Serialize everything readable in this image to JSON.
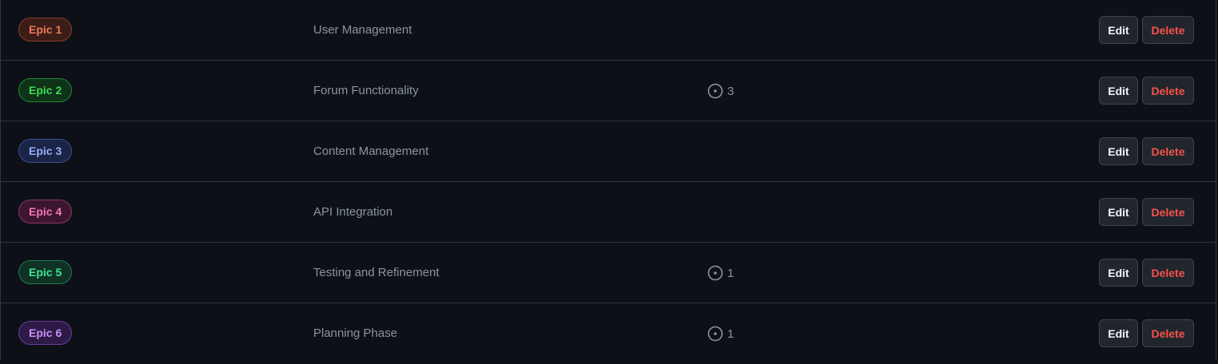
{
  "milestones": [
    {
      "label": "Epic 1",
      "description": "User Management",
      "open_issues": null,
      "color": "#f0785a",
      "bg": "#3a1d17",
      "border": "#8c3a28"
    },
    {
      "label": "Epic 2",
      "description": "Forum Functionality",
      "open_issues": "3",
      "color": "#3fdc54",
      "bg": "#0f3219",
      "border": "#238636"
    },
    {
      "label": "Epic 3",
      "description": "Content Management",
      "open_issues": null,
      "color": "#99aff5",
      "bg": "#1a2447",
      "border": "#3b4d8f"
    },
    {
      "label": "Epic 4",
      "description": "API Integration",
      "open_issues": null,
      "color": "#f776b6",
      "bg": "#3c1630",
      "border": "#8e3566"
    },
    {
      "label": "Epic 5",
      "description": "Testing and Refinement",
      "open_issues": "1",
      "color": "#3ee69a",
      "bg": "#0f3224",
      "border": "#1f7a4f"
    },
    {
      "label": "Epic 6",
      "description": "Planning Phase",
      "open_issues": "1",
      "color": "#cc8ff5",
      "bg": "#2e1a47",
      "border": "#6a3ea0"
    }
  ],
  "actions": {
    "edit_label": "Edit",
    "delete_label": "Delete"
  },
  "icons": {
    "issue": "issue-opened-icon"
  }
}
